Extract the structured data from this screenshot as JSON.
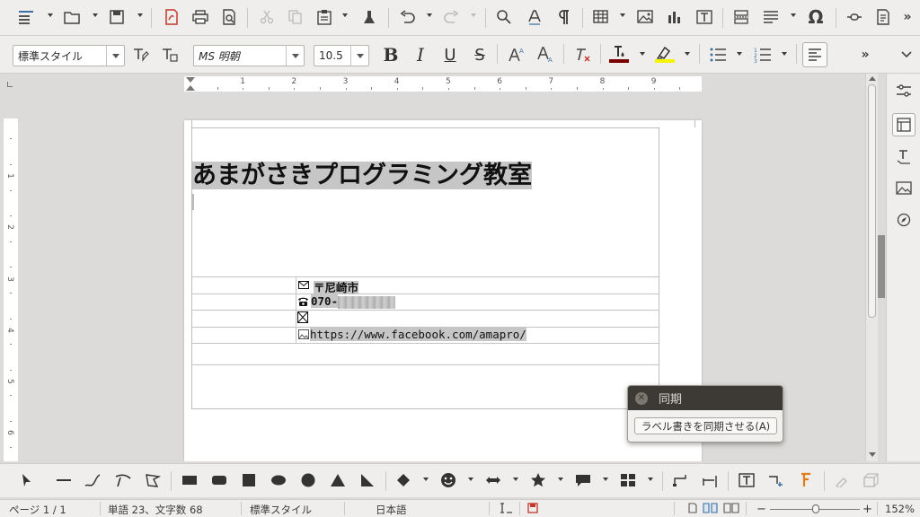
{
  "format_toolbar": {
    "paragraph_style": "標準スタイル",
    "font_name": "MS 明朝",
    "font_size": "10.5"
  },
  "document": {
    "title": "あまがさきプログラミング教室",
    "address": "〒尼崎市",
    "phone": "070-",
    "url": "https://www.facebook.com/amapro/"
  },
  "popup": {
    "title": "同期",
    "button_label": "ラベル書きを同期させる(A)"
  },
  "ruler": {
    "h_labels": [
      "1",
      "2",
      "3",
      "4",
      "5",
      "6",
      "7",
      "8",
      "9"
    ],
    "v_labels": [
      "1",
      "2",
      "3",
      "4",
      "5",
      "6"
    ]
  },
  "status_bar": {
    "page": "ページ 1 / 1",
    "word_count": "単語 23、文字数 68",
    "style": "標準スタイル",
    "language": "日本語",
    "zoom_minus": "−",
    "zoom_plus": "+",
    "zoom": "152%"
  },
  "colors": {
    "font_color": "#7a0000",
    "highlight_color": "#f5f500"
  }
}
